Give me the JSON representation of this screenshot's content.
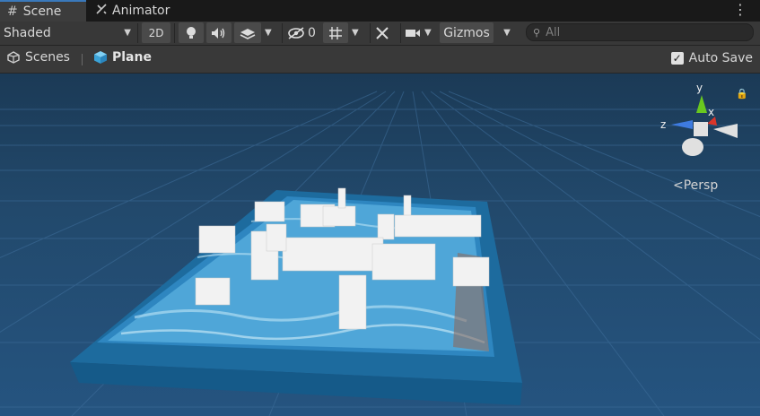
{
  "tabs": [
    {
      "label": "Scene",
      "icon": "grid-icon"
    },
    {
      "label": "Animator",
      "icon": "animator-icon"
    }
  ],
  "toolbar": {
    "shading_mode": "Shaded",
    "mode_2d": "2D",
    "hidden_count": "0",
    "gizmos_label": "Gizmos",
    "search_placeholder": "All"
  },
  "breadcrumb": {
    "root": "Scenes",
    "current": "Plane"
  },
  "auto_save": {
    "label": "Auto Save",
    "checked": true
  },
  "scene_gizmo": {
    "axis_y": "y",
    "axis_x": "x",
    "axis_z": "z",
    "projection": "Persp"
  },
  "colors": {
    "accent": "#3a79bb",
    "sky": "#22496c",
    "water": "#3c8dc4",
    "frame": "#1e6a9e",
    "fence": "#f2f2f2"
  }
}
